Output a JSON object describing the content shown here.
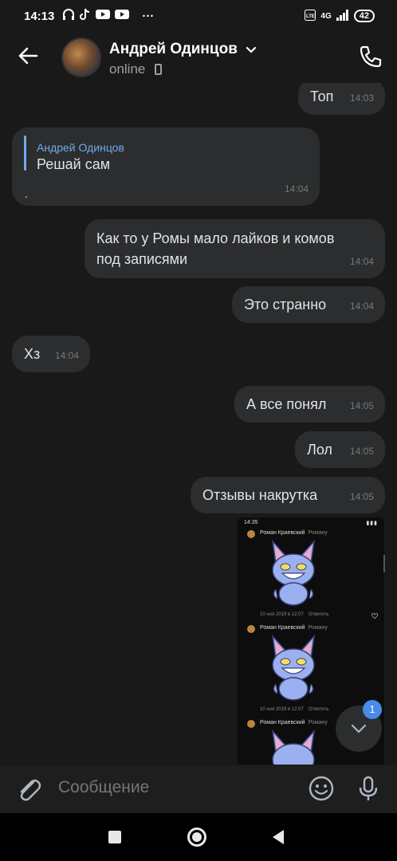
{
  "statusbar": {
    "time": "14:13",
    "network": "4G",
    "battery": "42",
    "more": "···"
  },
  "header": {
    "name": "Андрей Одинцов",
    "status": "online"
  },
  "messages": [
    {
      "text": "Топ",
      "time": "14:03"
    },
    {
      "reply_name": "Андрей Одинцов",
      "reply_text": "Решай сам",
      "text": ".",
      "time": "14:04"
    },
    {
      "text": "Как то у Ромы мало лайков и комов",
      "text2": "под записями",
      "time": "14:04"
    },
    {
      "text": "Это странно",
      "time": "14:04"
    },
    {
      "text": "Хз",
      "time": "14:04"
    },
    {
      "text": "А все понял",
      "time": "14:05"
    },
    {
      "text": "Лол",
      "time": "14:05"
    },
    {
      "text": "Отзывы накрутка",
      "time": "14:05"
    }
  ],
  "screenshot": {
    "time": "14:35",
    "user": "Роман Краевский",
    "to": "Роману",
    "date": "10 ноя 2019 в 12:07",
    "reply": "Ответить"
  },
  "unread_count": "1",
  "composer": {
    "placeholder": "Сообщение"
  },
  "colors": {
    "bubble": "#2c2d2e",
    "background": "#19191a",
    "accent": "#71aaeb",
    "badge": "#4a8ae8"
  }
}
